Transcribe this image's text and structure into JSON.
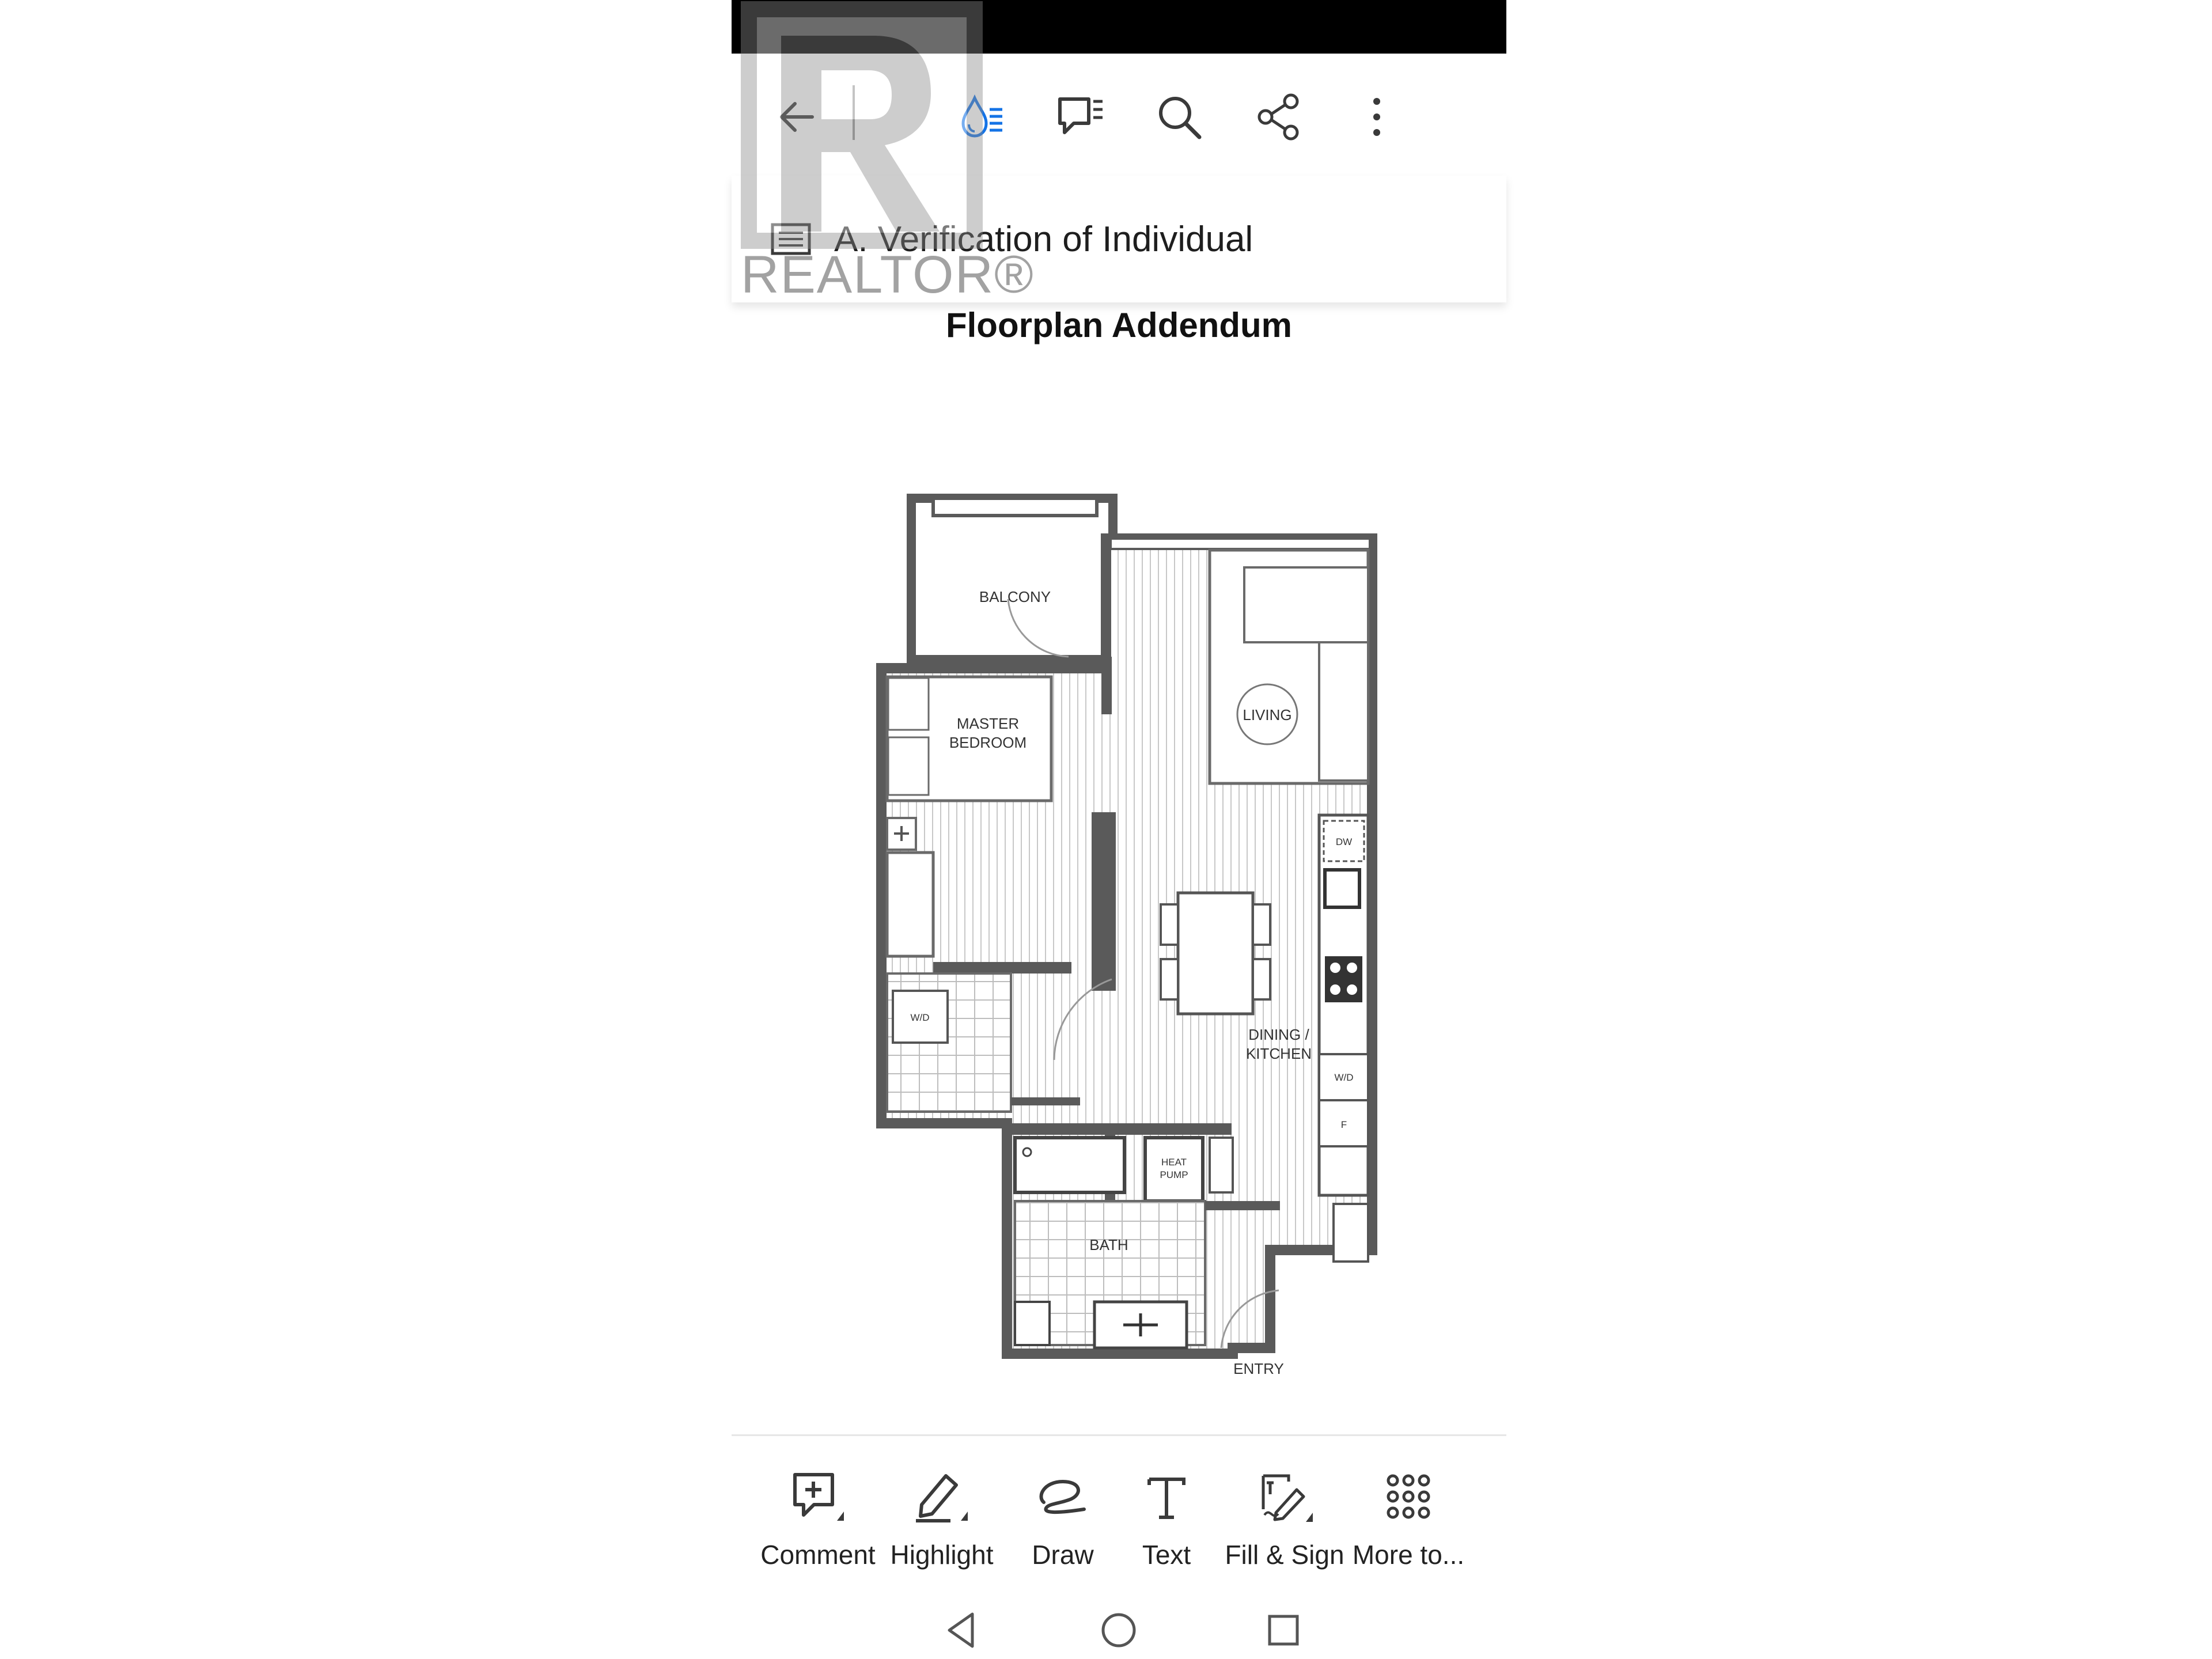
{
  "toolbar": {
    "back_icon": "arrow-left-icon",
    "liquid_mode_icon": "liquid-mode-icon",
    "comments_icon": "comments-list-icon",
    "search_icon": "search-icon",
    "share_icon": "share-icon",
    "more_icon": "more-vertical-icon",
    "accent_color": "#1473e6"
  },
  "document": {
    "section_title": "A. Verification of Individual",
    "page_title": "Floorplan Addendum"
  },
  "watermark": {
    "brand_text": "REALTOR®"
  },
  "floorplan": {
    "rooms": {
      "balcony": "BALCONY",
      "living": "LIVING",
      "master_bedroom_line1": "MASTER",
      "master_bedroom_line2": "BEDROOM",
      "dining_kitchen_line1": "DINING /",
      "dining_kitchen_line2": "KITCHEN",
      "bath": "BATH",
      "entry": "ENTRY",
      "heat_pump_line1": "HEAT",
      "heat_pump_line2": "PUMP",
      "wd_bedroom": "W/D",
      "wd_kitchen": "W/D",
      "dw": "DW",
      "fridge": "F"
    }
  },
  "tools": {
    "comment": "Comment",
    "highlight": "Highlight",
    "draw": "Draw",
    "text": "Text",
    "fill_sign": "Fill & Sign",
    "more": "More to..."
  },
  "nav": {
    "back_icon": "nav-back-triangle-icon",
    "home_icon": "nav-home-circle-icon",
    "recents_icon": "nav-recents-square-icon"
  }
}
